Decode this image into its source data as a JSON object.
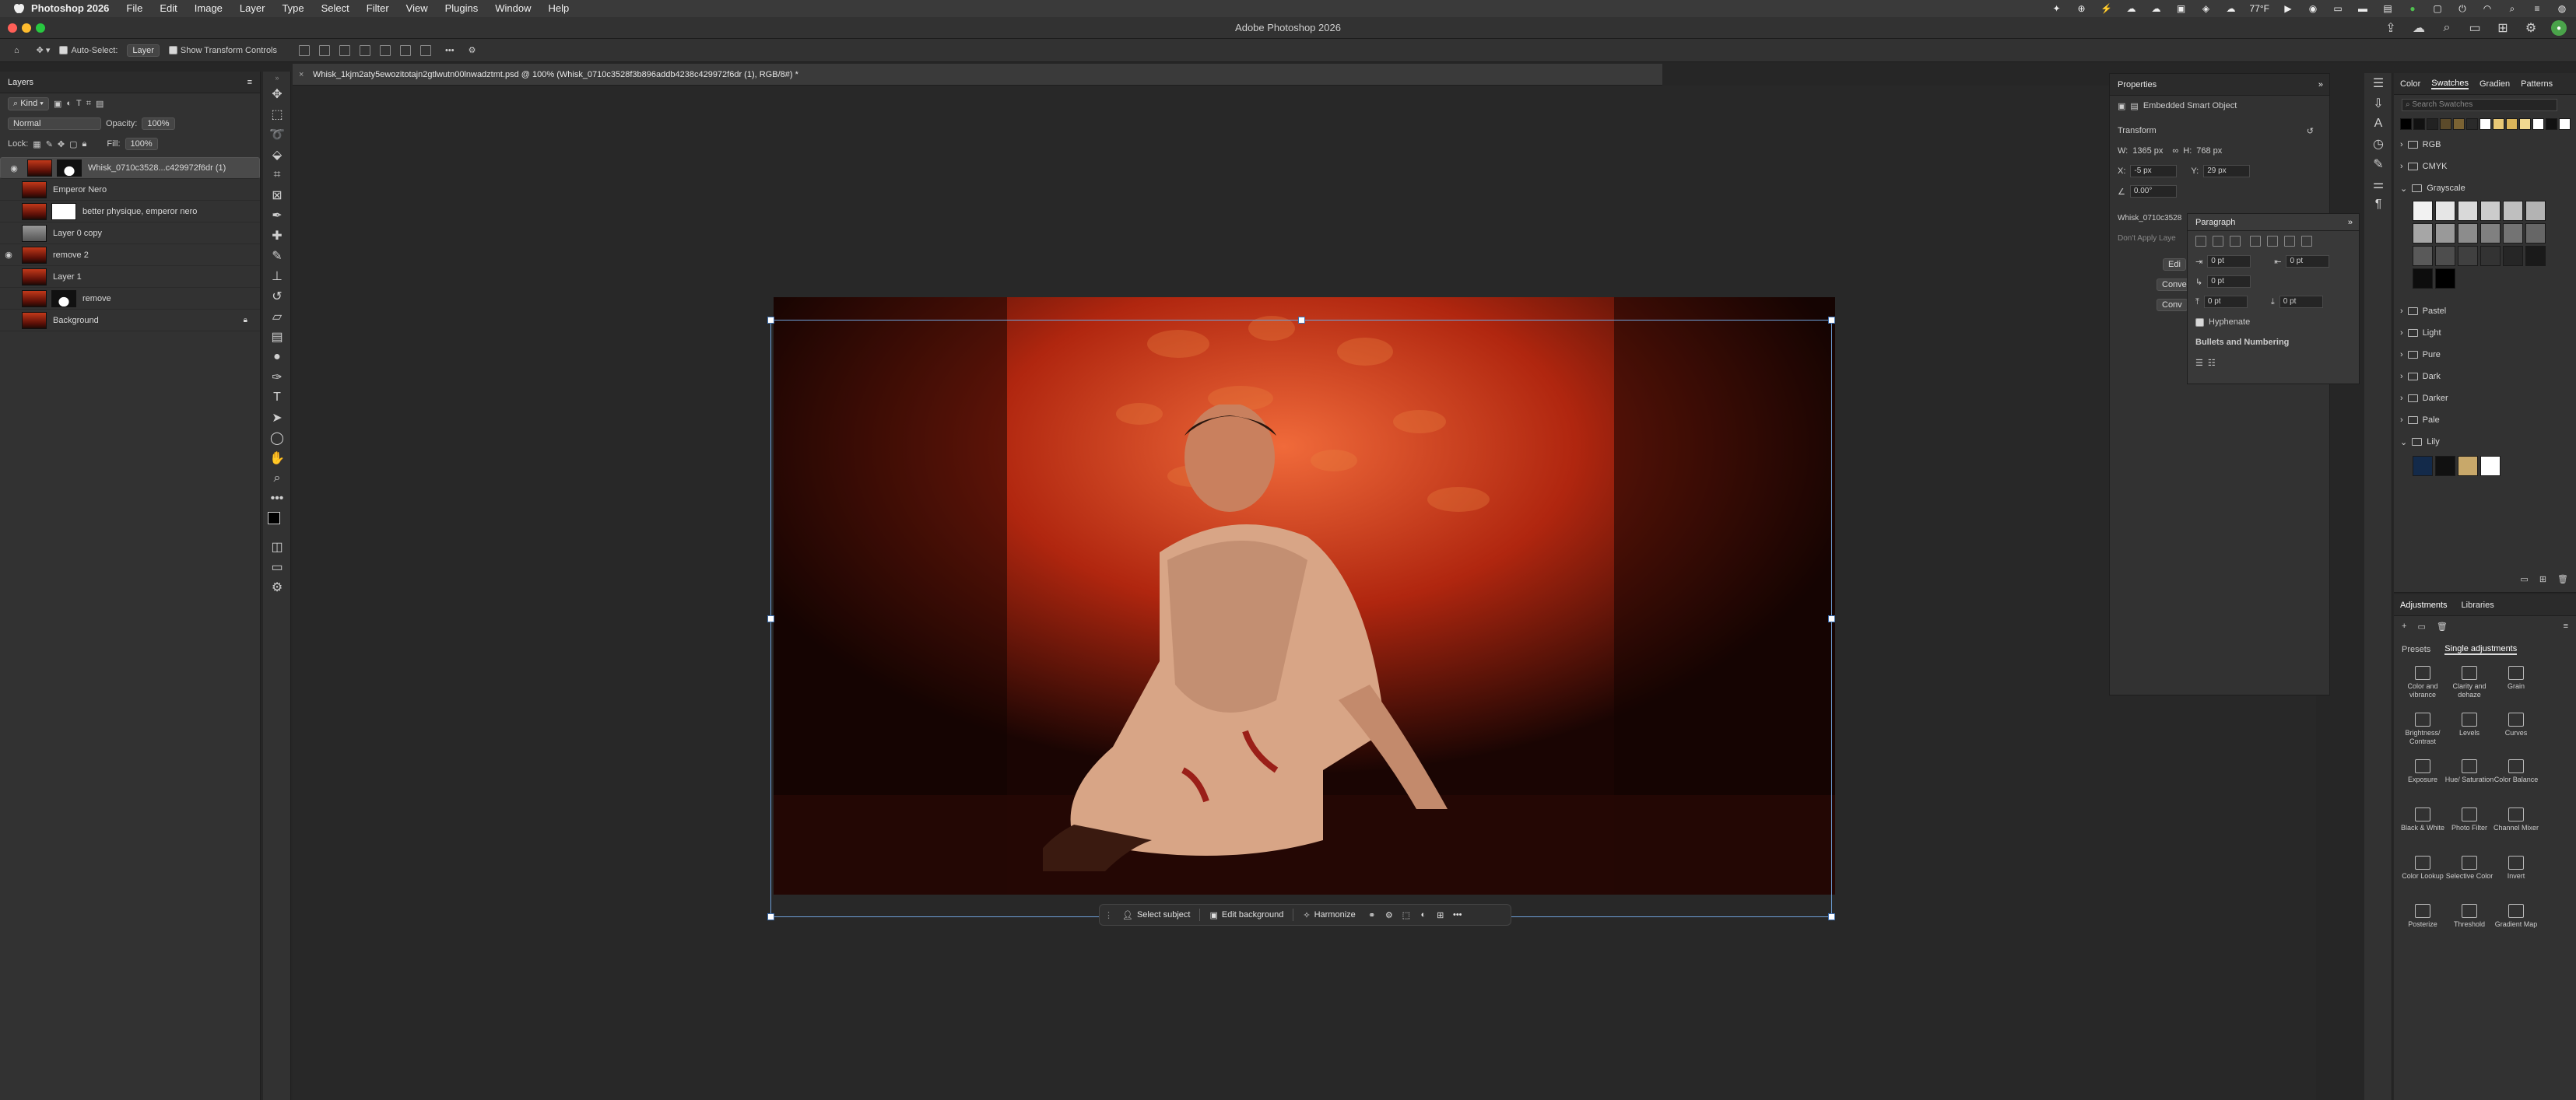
{
  "menubar": {
    "app": "Photoshop 2026",
    "items": [
      "File",
      "Edit",
      "Image",
      "Layer",
      "Type",
      "Select",
      "Filter",
      "View",
      "Plugins",
      "Window",
      "Help"
    ],
    "weather": "77°F"
  },
  "titlebar": {
    "title": "Adobe Photoshop 2026"
  },
  "options": {
    "auto_select": "Auto-Select:",
    "target": "Layer",
    "transform": "Show Transform Controls"
  },
  "document": {
    "tab": "Whisk_1kjm2aty5ewozitotajn2gtlwutn00lnwadztmt.psd @ 100% (Whisk_0710c3528f3b896addb4238c429972f6dr (1), RGB/8#) *"
  },
  "layers": {
    "tab": "Layers",
    "kind": "Kind",
    "blend": "Normal",
    "opacity_label": "Opacity:",
    "opacity": "100%",
    "lock_label": "Lock:",
    "fill_label": "Fill:",
    "fill": "100%",
    "items": [
      {
        "name": "Whisk_0710c3528...c429972f6dr (1)",
        "visible": true,
        "selected": true
      },
      {
        "name": "Emperor Nero",
        "visible": false
      },
      {
        "name": "better physique, emperor nero",
        "visible": false
      },
      {
        "name": "Layer 0 copy",
        "visible": false
      },
      {
        "name": "remove 2",
        "visible": true
      },
      {
        "name": "Layer 1",
        "visible": false
      },
      {
        "name": "remove",
        "visible": false
      },
      {
        "name": "Background",
        "visible": false
      }
    ]
  },
  "context": {
    "select_subject": "Select subject",
    "edit_background": "Edit background",
    "harmonize": "Harmonize"
  },
  "properties": {
    "tab": "Properties",
    "type": "Embedded Smart Object",
    "transform": "Transform",
    "w_label": "W:",
    "w": "1365 px",
    "h_label": "H:",
    "h": "768 px",
    "x_label": "X:",
    "x": "-5 px",
    "y_label": "Y:",
    "y": "29 px",
    "angle": "0.00°",
    "file": "Whisk_0710c3528",
    "dont_apply": "Don't Apply Laye",
    "edit": "Edi",
    "convert1": "Conve",
    "convert2": "Conv"
  },
  "paragraph": {
    "tab": "Paragraph",
    "indent_left": "0 pt",
    "indent_right": "0 pt",
    "first_line": "0 pt",
    "space_before": "0 pt",
    "space_after": "0 pt",
    "hyphenate": "Hyphenate",
    "bullets": "Bullets and Numbering"
  },
  "swatches": {
    "tabs": [
      "Color",
      "Swatches",
      "Gradien",
      "Patterns"
    ],
    "search": "Search Swatches",
    "groups": [
      "RGB",
      "CMYK",
      "Grayscale",
      "Pastel",
      "Light",
      "Pure",
      "Dark",
      "Darker",
      "Pale",
      "Lily"
    ],
    "recent": [
      "#000000",
      "#111111",
      "#222222",
      "#5b4a2a",
      "#7a6233",
      "#2a2a2a",
      "#ffffff",
      "#e8c876",
      "#d9b45a",
      "#f0d890",
      "#ffffff",
      "#111111",
      "#ffffff"
    ],
    "gray": [
      "#f2f2f2",
      "#e6e6e6",
      "#d9d9d9",
      "#cccccc",
      "#bfbfbf",
      "#b3b3b3",
      "#a6a6a6",
      "#999999",
      "#8c8c8c",
      "#808080",
      "#737373",
      "#666666",
      "#595959",
      "#4d4d4d",
      "#404040",
      "#333333",
      "#262626",
      "#1a1a1a",
      "#0d0d0d",
      "#000000"
    ],
    "lily": [
      "#132a4a",
      "#111111",
      "#c8a86a",
      "#ffffff"
    ]
  },
  "adjustments": {
    "tabs": [
      "Adjustments",
      "Libraries"
    ],
    "subtabs": [
      "Presets",
      "Single adjustments"
    ],
    "items": [
      "Color and vibrance",
      "Clarity and dehaze",
      "Grain",
      "Brightness/ Contrast",
      "Levels",
      "Curves",
      "Exposure",
      "Hue/ Saturation",
      "Color Balance",
      "Black & White",
      "Photo Filter",
      "Channel Mixer",
      "Color Lookup",
      "Selective Color",
      "Invert",
      "Posterize",
      "Threshold",
      "Gradient Map"
    ]
  }
}
